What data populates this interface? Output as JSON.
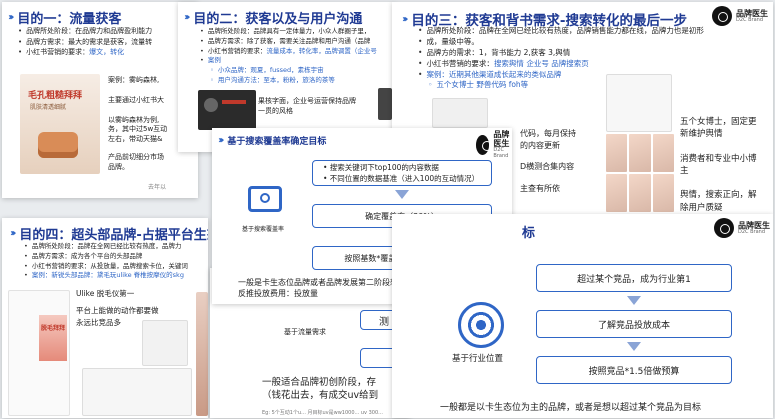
{
  "slide1": {
    "title": "目的一：流量获客",
    "bullets": [
      "品牌所处阶段：在品牌力和品牌盈利能力",
      "品牌方需求：最大的需求是获客，流量转",
      "小红书营销的要求："
    ],
    "highlight": "爆文，转化",
    "product_text": "毛孔粗糙拜拜",
    "product_sub": "肌肤清透细腻",
    "case_lines": [
      "案例：雾屿森林,",
      "主要通过小红书大",
      "以雾屿森林为例,",
      "务，其中过5w互动",
      "左右，带动天猫&",
      "产品前切细分市场",
      "品牌。"
    ],
    "footnote": "去年以"
  },
  "slide2": {
    "title": "目的二：获客以及与用户沟通",
    "bullets": [
      "品牌所处阶段：品牌具有一定体量力，小众人群圈子里，",
      "品牌方需求：除了获客，需要关注品牌和用户沟通（品牌",
      "小红书营销的要求："
    ],
    "highlight": "流量成本，转化率，品牌调置（企业号",
    "highlight_case": "案例",
    "sub_bullets": [
      "小众品牌：观夏，fussed，素栋宇宙",
      "用户沟通方法：至本，粉粉，旅洛的茶等"
    ],
    "side_text": [
      "果核字面，企业号运营保持品牌",
      "一贯的风格"
    ]
  },
  "slide3": {
    "title": "目的三：获客和背书需求-搜索转化的最后一步",
    "bullets": [
      "品牌所处阶段：品牌在全网已经比较有热度，品牌销售能力都在线，品牌力也是初形",
      "成，量级中等。",
      "品牌方的需求：1，背书能力 2,获客 3,舆情",
      "小红书营销的要求："
    ],
    "highlight": "搜索舆情 企业号 品牌搜索页",
    "case": "案例：近期其他渠道成长起来的类似品牌",
    "sub_case": "五个女博士 野兽代码 foh等",
    "left_texts": [
      "代码，每月保持",
      "的内容更新",
      "D横测合集内容",
      "主查有所依"
    ],
    "right_texts": [
      "五个女博士，固定更",
      "新维护舆情",
      "消费者和专业中小博",
      "主",
      "舆情，搜索正向，解",
      "除用户质疑"
    ],
    "brand_name": "品牌医生",
    "brand_sub": "D2C Brand"
  },
  "slide_search": {
    "title": "基于搜索覆盖率确定目标",
    "flow": [
      "• 搜索关键词下top100的内容数据",
      "• 不同位置的数据基准（进入100的互动情况）",
      "确定覆盖率（30%）",
      "按照基数*覆盖率*100*互动成本"
    ],
    "icon_label": "基于搜索覆盖率",
    "note_1": "一般是卡生态位品牌或者品牌发展第二阶段想要卡类目的品牌",
    "note_2": "反推投放费用：投放量",
    "brand_name": "品牌医生",
    "brand_sub": "D2C Brand"
  },
  "slide4": {
    "title": "目的四：超头部品牌-占据平台生态",
    "bullets": [
      "品牌所处阶段：品牌在全网已经比较有热度，品牌力",
      "品牌方需求：成为各个平台的头部品牌",
      "小红书营销的要求：从投放量，品牌搜索卡位，关键词"
    ],
    "case": "案例：新锐头部品牌：黛毛玩ulike 脊椎按摩仪的skg",
    "brand_label": "Ulike 脱毛仪第一",
    "line_2": "平台上能做的动作都要做",
    "line_3": "永远比竞品多",
    "poster_text": "脱毛拜拜"
  },
  "slide_comp": {
    "title": "标",
    "flow": [
      "超过某个竞品，成为行业第1",
      "了解竞品投放成本",
      "按照竞品*1.5倍做预算"
    ],
    "icon_label": "基于行业位置",
    "note": "一般都是以卡生态位为主的品牌，或者是想以超过某个竞品为目标",
    "brand_name": "品牌医生",
    "brand_sub": "D2C Brand"
  },
  "slide_traffic": {
    "icon_label": "基于流量需求",
    "box_partial_1": "测",
    "note": "一般适合品牌初创阶段，存",
    "note_2": "（钱花出去，有成交uv给到",
    "footnote": "Eg: 5个互动1个u... 月目标uv是ww1000... uv 300..."
  },
  "colors": {
    "accent": "#2f66c6",
    "title": "#1f3a93"
  }
}
